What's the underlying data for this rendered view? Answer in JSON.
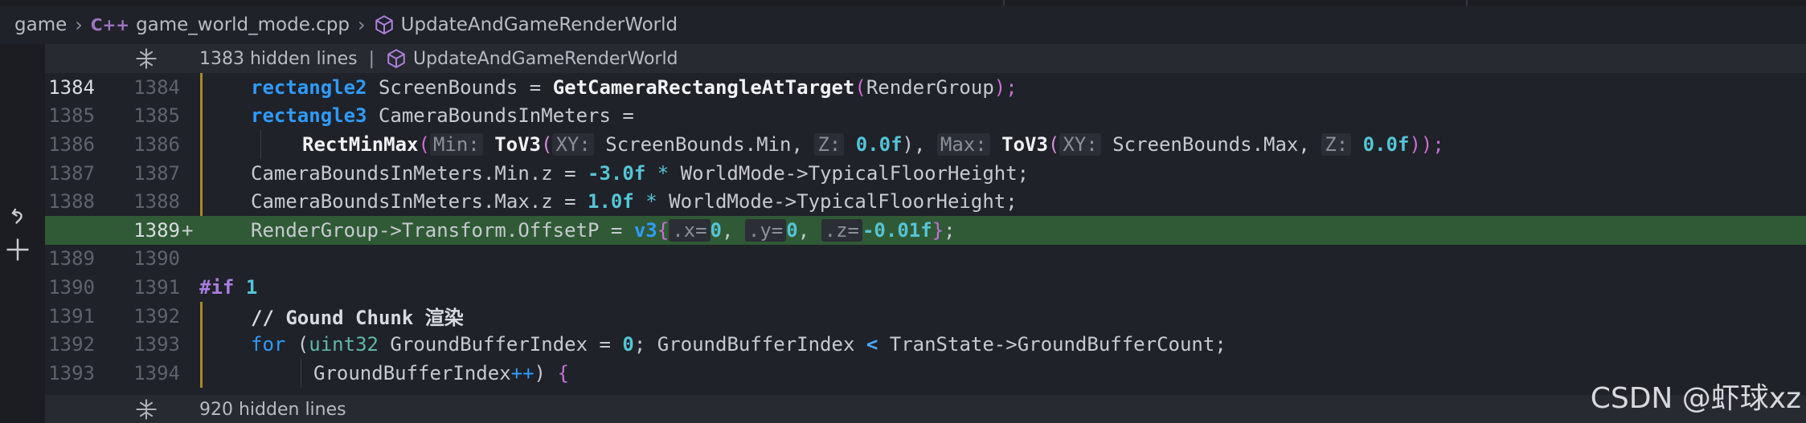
{
  "breadcrumb": {
    "items": [
      "game",
      "game_world_mode.cpp",
      "UpdateAndGameRenderWorld"
    ],
    "cpp_badge": "C++"
  },
  "fold_top": {
    "text": "1383 hidden lines",
    "separator": "|",
    "symbol": "UpdateAndGameRenderWorld"
  },
  "fold_bottom": {
    "text": "920 hidden lines"
  },
  "lines": [
    {
      "left": "1384",
      "right": "1384"
    },
    {
      "left": "1385",
      "right": "1385"
    },
    {
      "left": "1386",
      "right": "1386"
    },
    {
      "left": "1387",
      "right": "1387"
    },
    {
      "left": "1388",
      "right": "1388"
    },
    {
      "left": "",
      "right": "1389",
      "marker": "+"
    },
    {
      "left": "1389",
      "right": "1390"
    },
    {
      "left": "1390",
      "right": "1391"
    },
    {
      "left": "1391",
      "right": "1392"
    },
    {
      "left": "1392",
      "right": "1393"
    },
    {
      "left": "1393",
      "right": "1394"
    }
  ],
  "code": {
    "l1": [
      "rectangle2",
      " ScreenBounds = ",
      "GetCameraRectangleAtTarget",
      "(",
      "RenderGroup",
      ");"
    ],
    "l2": [
      "rectangle3",
      " CameraBoundsInMeters ="
    ],
    "l3": [
      "RectMinMax",
      "(",
      "Min:",
      " ",
      "ToV3",
      "(",
      "XY:",
      " ScreenBounds.Min, ",
      "Z:",
      " ",
      "0.0f",
      "), ",
      "Max:",
      " ",
      "ToV3",
      "(",
      "XY:",
      " ScreenBounds.Max, ",
      "Z:",
      " ",
      "0.0f",
      "));"
    ],
    "l4": [
      "CameraBoundsInMeters.Min.z = ",
      "-3.0f",
      " ",
      "*",
      " WorldMode->TypicalFloorHeight;"
    ],
    "l5": [
      "CameraBoundsInMeters.Max.z = ",
      "1.0f",
      " ",
      "*",
      " WorldMode->TypicalFloorHeight;"
    ],
    "l6": [
      "RenderGroup->Transform.OffsetP = ",
      "v3",
      "{",
      ".x=",
      "0",
      ", ",
      ".y=",
      "0",
      ", ",
      ".z=",
      "-0.01f",
      "}",
      ";"
    ],
    "l7": [
      ""
    ],
    "l8": [
      "#if",
      " ",
      "1"
    ],
    "l9": [
      "// Gound Chunk 渲染"
    ],
    "l10": [
      "for",
      " (",
      "uint32",
      " GroundBufferIndex = ",
      "0",
      "; GroundBufferIndex ",
      "<",
      " TranState->GroundBufferCount;"
    ],
    "l11": [
      "GroundBufferIndex",
      "++",
      ") ",
      "{"
    ]
  },
  "watermark": "CSDN @虾球xz",
  "colors": {
    "background": "#1f2228",
    "added_line": "#2f5a35",
    "fold_bar": "#272a31"
  },
  "icons": {
    "cpp": "cpp-file-icon",
    "symbol": "cube-symbol-icon",
    "expand": "unfold-icon",
    "revert": "revert-change-icon",
    "add": "plus-icon"
  }
}
